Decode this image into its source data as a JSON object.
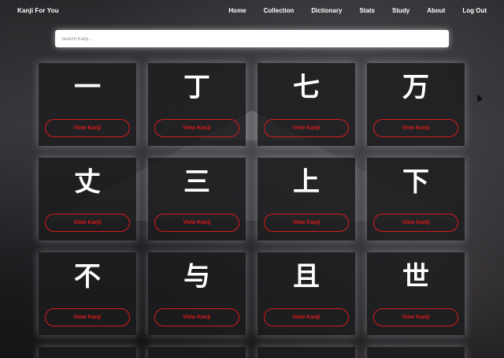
{
  "app": {
    "brand": "Kanji For You"
  },
  "nav": {
    "items": [
      {
        "label": "Home",
        "name": "nav-home"
      },
      {
        "label": "Collection",
        "name": "nav-collection"
      },
      {
        "label": "Dictionary",
        "name": "nav-dictionary"
      },
      {
        "label": "Stats",
        "name": "nav-stats"
      },
      {
        "label": "Study",
        "name": "nav-study"
      },
      {
        "label": "About",
        "name": "nav-about"
      },
      {
        "label": "Log Out",
        "name": "nav-logout"
      }
    ]
  },
  "search": {
    "placeholder": "Search Kanji...",
    "value": ""
  },
  "cards": [
    {
      "kanji": "一",
      "button_label": "View Kanji"
    },
    {
      "kanji": "丁",
      "button_label": "View Kanji"
    },
    {
      "kanji": "七",
      "button_label": "View Kanji"
    },
    {
      "kanji": "万",
      "button_label": "View Kanji"
    },
    {
      "kanji": "丈",
      "button_label": "View Kanji"
    },
    {
      "kanji": "三",
      "button_label": "View Kanji"
    },
    {
      "kanji": "上",
      "button_label": "View Kanji"
    },
    {
      "kanji": "下",
      "button_label": "View Kanji"
    },
    {
      "kanji": "不",
      "button_label": "View Kanji"
    },
    {
      "kanji": "与",
      "button_label": "View Kanji"
    },
    {
      "kanji": "且",
      "button_label": "View Kanji"
    },
    {
      "kanji": "世",
      "button_label": "View Kanji"
    }
  ],
  "colors": {
    "accent": "#d81a1a",
    "card_bg": "#1c1c1e",
    "text": "#ffffff"
  }
}
